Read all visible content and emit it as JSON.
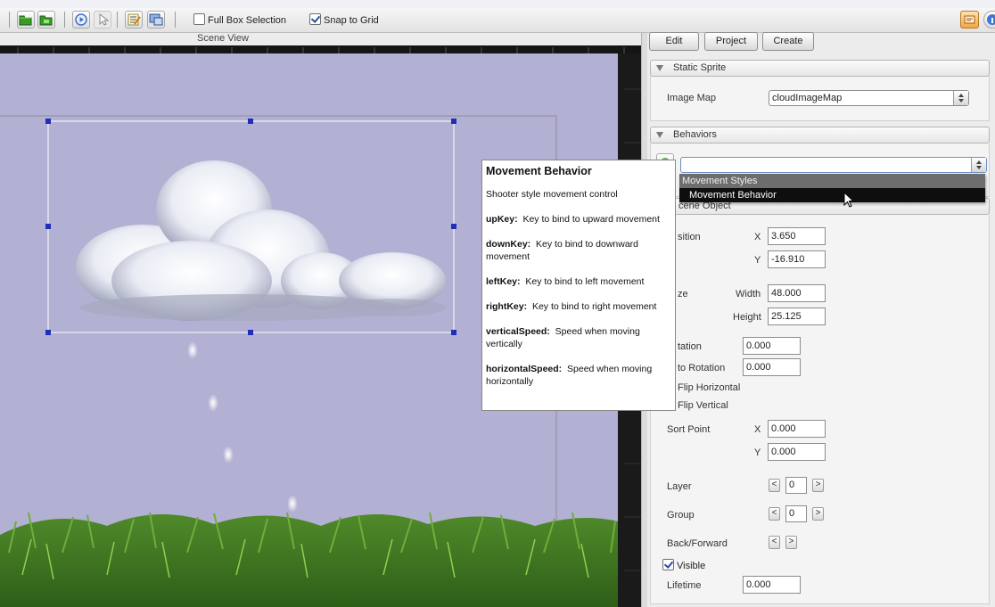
{
  "toolbar": {
    "full_box_selection": "Full Box Selection",
    "full_box_selection_checked": false,
    "snap_to_grid": "Snap to Grid",
    "snap_to_grid_checked": true
  },
  "scene": {
    "label": "Scene View"
  },
  "tooltip": {
    "title": "Movement Behavior",
    "description": "Shooter style movement control",
    "params": [
      {
        "key": "upKey:",
        "text": "Key to bind to upward movement"
      },
      {
        "key": "downKey:",
        "text": "Key to bind to downward movement"
      },
      {
        "key": "leftKey:",
        "text": "Key to bind to left movement"
      },
      {
        "key": "rightKey:",
        "text": "Key to bind to right movement"
      },
      {
        "key": "verticalSpeed:",
        "text": "Speed when moving vertically"
      },
      {
        "key": "horizontalSpeed:",
        "text": "Speed when moving horizontally"
      }
    ]
  },
  "tabs": {
    "edit": "Edit",
    "project": "Project",
    "create": "Create"
  },
  "static_sprite": {
    "title": "Static Sprite",
    "image_map_label": "Image Map",
    "image_map_value": "cloudImageMap"
  },
  "behaviors": {
    "title": "Behaviors",
    "select_value": "",
    "dropdown_group": "Movement Styles",
    "dropdown_item": "Movement Behavior"
  },
  "scene_object": {
    "title_partial": "cene Object",
    "position_label": "sition",
    "x_label": "X",
    "y_label": "Y",
    "position_x": "3.650",
    "position_y": "-16.910",
    "size_label": "ze",
    "width_label": "Width",
    "height_label": "Height",
    "width": "48.000",
    "height": "25.125",
    "rotation_label": "tation",
    "rotation": "0.000",
    "auto_rotation_label": "to Rotation",
    "auto_rotation": "0.000",
    "flip_h_label": "Flip Horizontal",
    "flip_v_label": "Flip Vertical",
    "sort_point_label": "Sort Point",
    "sort_x": "0.000",
    "sort_y": "0.000",
    "layer_label": "Layer",
    "layer": "0",
    "group_label": "Group",
    "group": "0",
    "back_forward_label": "Back/Forward",
    "spin_left": "<",
    "spin_right": ">",
    "visible_label": "Visible",
    "visible_checked": true,
    "lifetime_label": "Lifetime",
    "lifetime": "0.000"
  },
  "colors": {
    "canvas_bg": "#b2b0d3",
    "selection_handle": "#1f2fb8",
    "dropdown_highlight": "#0e0e0e"
  },
  "icons": [
    "open-folder-icon",
    "save-folder-icon",
    "play-icon",
    "pointer-icon",
    "edit-script-icon",
    "display-icon",
    "media-icon",
    "info-icon"
  ]
}
